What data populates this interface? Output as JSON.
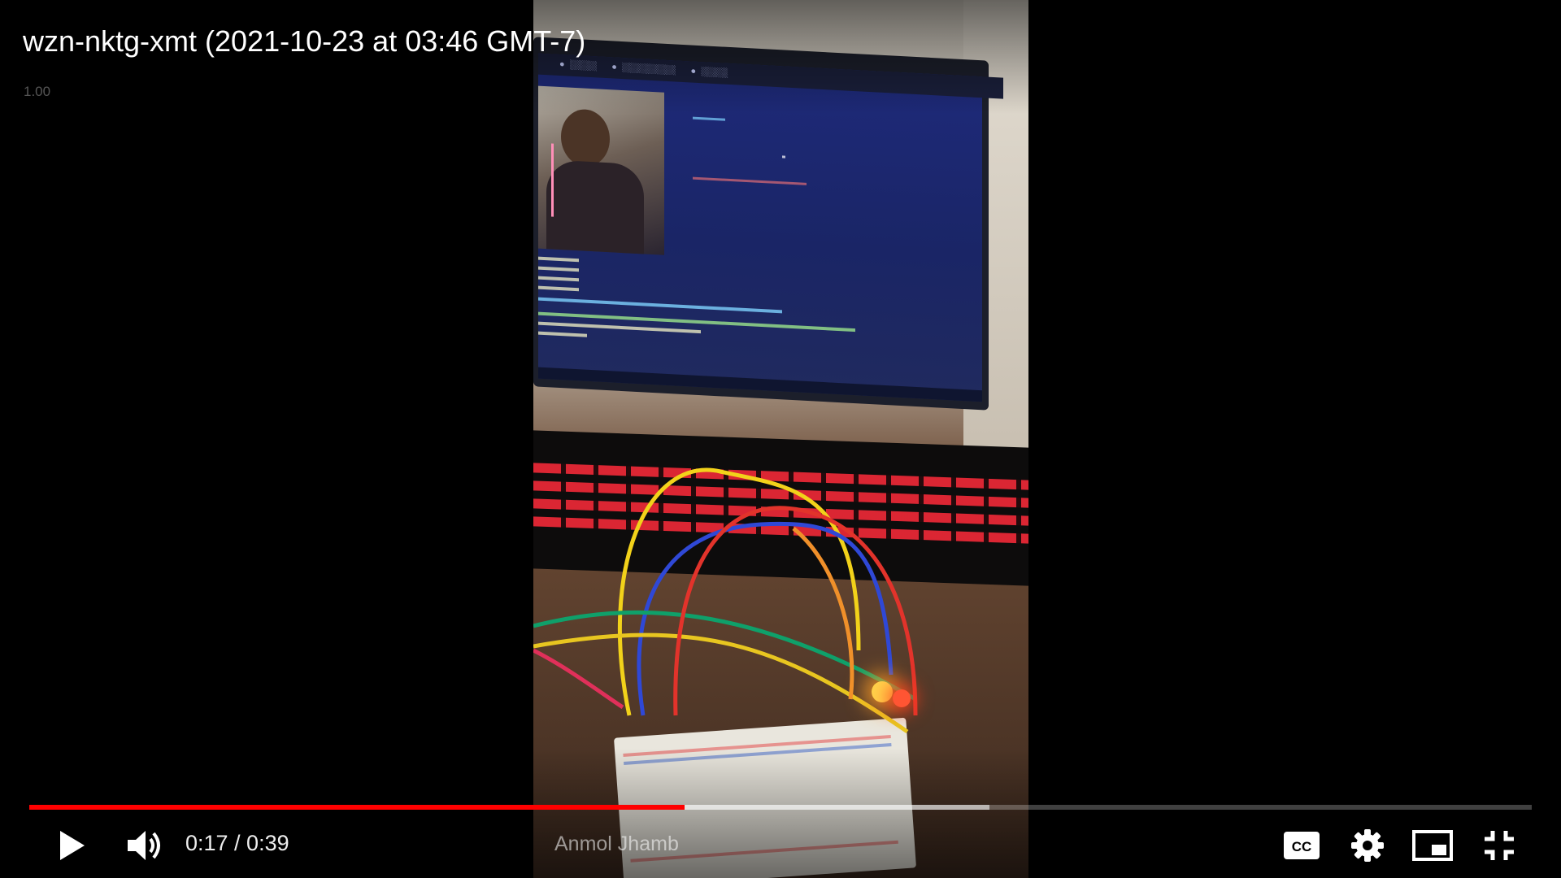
{
  "video": {
    "title": "wzn-nktg-xmt (2021-10-23 at 03:46 GMT-7)",
    "speed": "1.00",
    "watermark": "Anmol Jhamb",
    "current_time": "0:17",
    "duration": "0:39",
    "time_display": "0:17 / 0:39",
    "progress_fraction": 0.436,
    "buffered_fraction": 0.639
  },
  "controls": {
    "play_icon": "play-icon",
    "volume_icon": "volume-icon",
    "captions_icon": "captions-icon",
    "settings_icon": "gear-icon",
    "miniplayer_icon": "miniplayer-icon",
    "exit_fullscreen_icon": "exit-fullscreen-icon"
  },
  "colors": {
    "progress_played": "#ff0000",
    "background": "#000000"
  }
}
